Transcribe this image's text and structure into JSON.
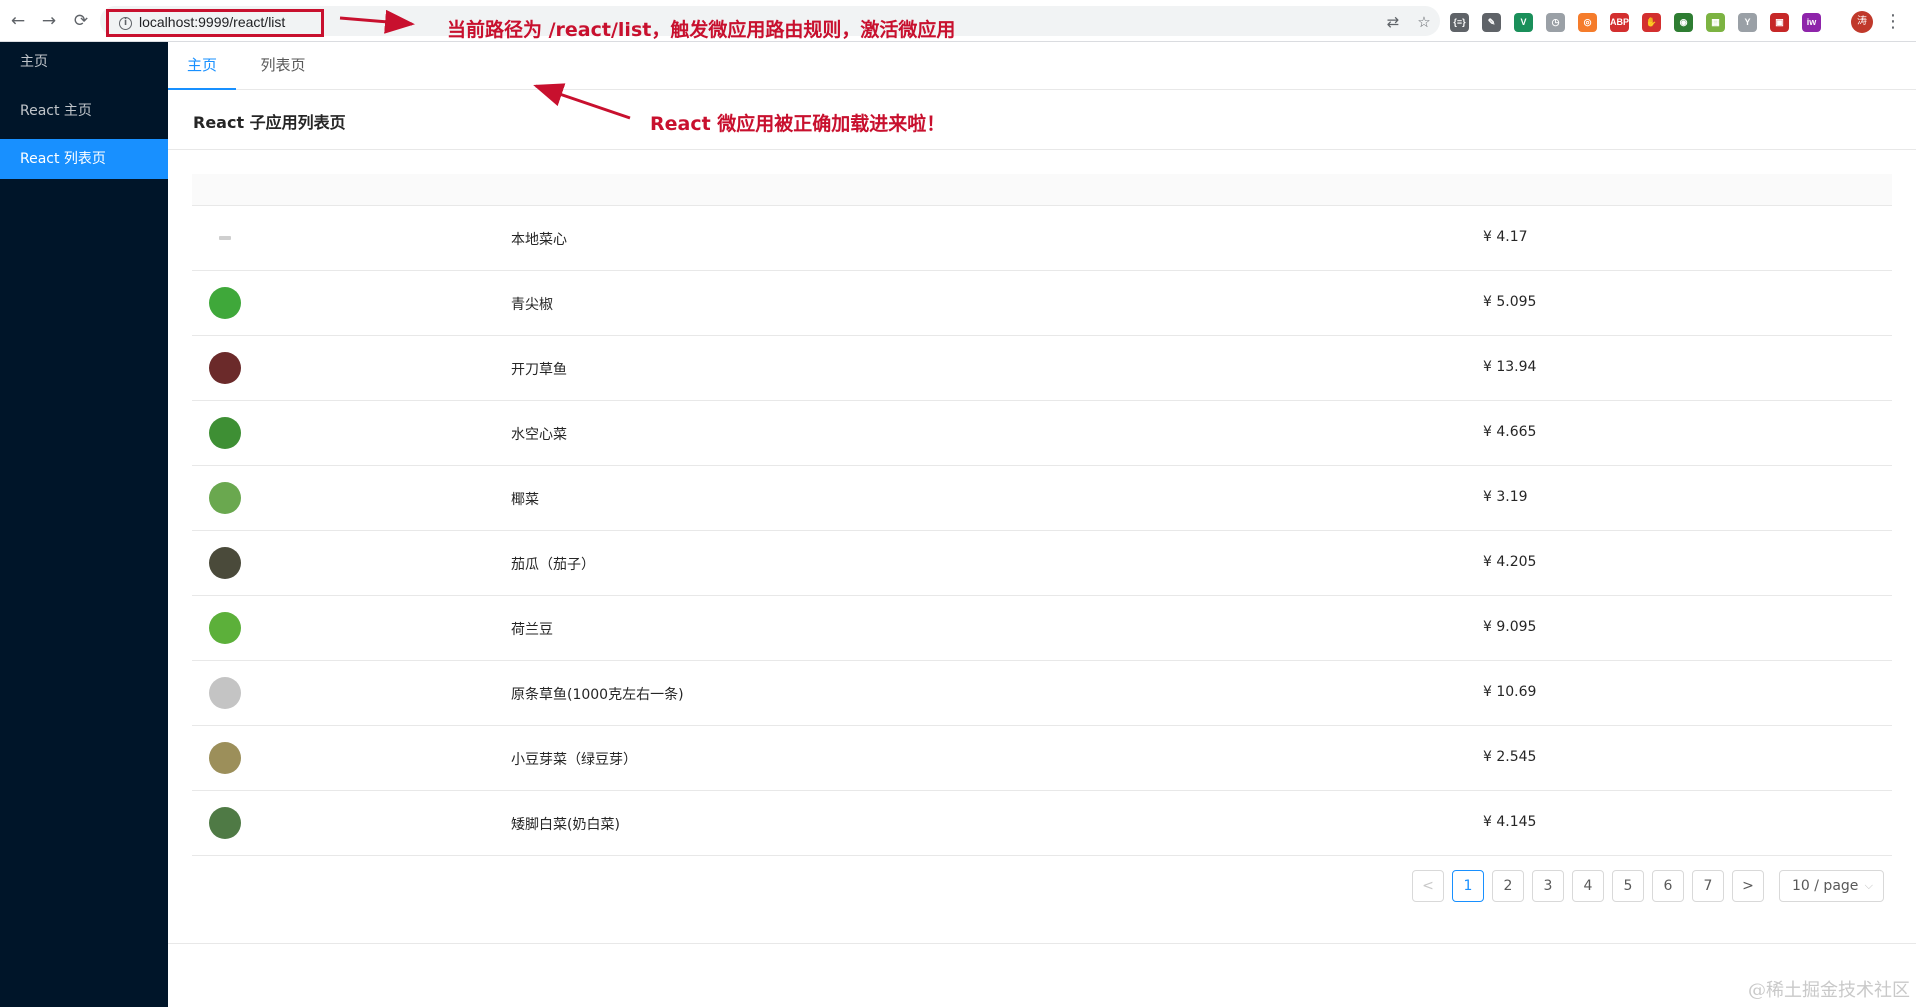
{
  "browser": {
    "url": "localhost:9999/react/list",
    "nav": {
      "back": "←",
      "forward": "→",
      "reload": "⟳"
    },
    "avatar_text": "涛",
    "extensions": [
      {
        "icon": "braces-icon",
        "label": "{≡}",
        "color": "#5f6368"
      },
      {
        "icon": "pen-icon",
        "label": "✎",
        "color": "#5f6368"
      },
      {
        "icon": "vue-devtools-icon",
        "label": "V",
        "color": "#1a8f5a"
      },
      {
        "icon": "clock-icon",
        "label": "◷",
        "color": "#9aa0a6"
      },
      {
        "icon": "orange-ext-icon",
        "label": "◎",
        "color": "#f57c2b"
      },
      {
        "icon": "adblock-plus-icon",
        "label": "ABP",
        "color": "#d32f2f"
      },
      {
        "icon": "stop-icon",
        "label": "✋",
        "color": "#d32f2f"
      },
      {
        "icon": "green-ext-icon",
        "label": "◉",
        "color": "#2e7d32"
      },
      {
        "icon": "qr-code-icon",
        "label": "▦",
        "color": "#7cb342"
      },
      {
        "icon": "y-ext-icon",
        "label": "Y",
        "color": "#9aa0a6"
      },
      {
        "icon": "red-ext-icon",
        "label": "▣",
        "color": "#c62828"
      },
      {
        "icon": "purple-ext-icon",
        "label": "iw",
        "color": "#8e24aa"
      }
    ]
  },
  "annotations": {
    "url_note": "当前路径为 /react/list，触发微应用路由规则，激活微应用",
    "load_note": "React 微应用被正确加载进来啦！"
  },
  "sidebar": {
    "items": [
      {
        "label": "主页"
      },
      {
        "label": "React 主页"
      },
      {
        "label": "React 列表页"
      }
    ]
  },
  "tabs": [
    {
      "label": "主页"
    },
    {
      "label": "列表页"
    }
  ],
  "page": {
    "title": "React 子应用列表页"
  },
  "table": {
    "rows": [
      {
        "name": "本地菜心",
        "price": "¥ 4.17",
        "thumb": "#cfcfcf"
      },
      {
        "name": "青尖椒",
        "price": "¥ 5.095",
        "thumb": "#3fa83a"
      },
      {
        "name": "开刀草鱼",
        "price": "¥ 13.94",
        "thumb": "#6b2a2a"
      },
      {
        "name": "水空心菜",
        "price": "¥ 4.665",
        "thumb": "#3e8f34"
      },
      {
        "name": "椰菜",
        "price": "¥ 3.19",
        "thumb": "#6aa84f"
      },
      {
        "name": "茄瓜（茄子）",
        "price": "¥ 4.205",
        "thumb": "#4a4a3a"
      },
      {
        "name": "荷兰豆",
        "price": "¥ 9.095",
        "thumb": "#5cb03a"
      },
      {
        "name": "原条草鱼(1000克左右一条)",
        "price": "¥ 10.69",
        "thumb": "#c4c4c4"
      },
      {
        "name": "小豆芽菜（绿豆芽）",
        "price": "¥ 2.545",
        "thumb": "#9c8f5a"
      },
      {
        "name": "矮脚白菜(奶白菜)",
        "price": "¥ 4.145",
        "thumb": "#4f7a45"
      }
    ]
  },
  "pagination": {
    "prev": "<",
    "next": ">",
    "pages": [
      "1",
      "2",
      "3",
      "4",
      "5",
      "6",
      "7"
    ],
    "current": "1",
    "page_size": "10 / page"
  },
  "watermark": "@稀土掘金技术社区"
}
